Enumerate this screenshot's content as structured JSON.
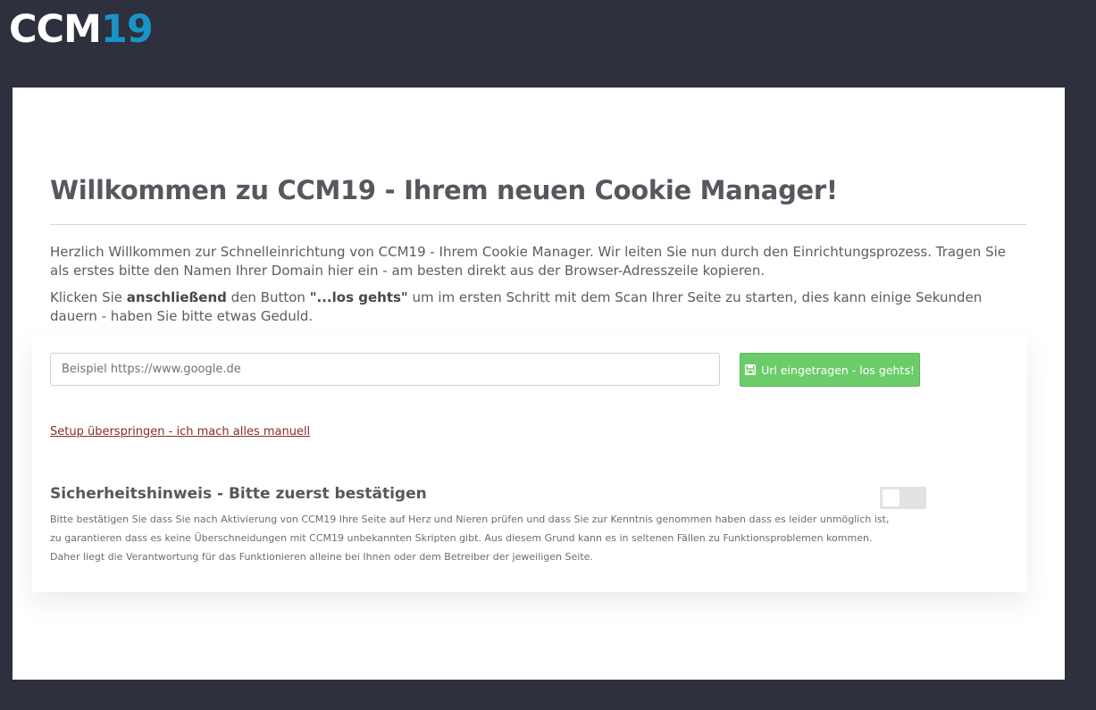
{
  "logo": {
    "part1": "CCM",
    "part2": "19"
  },
  "page": {
    "title": "Willkommen zu CCM19 - Ihrem neuen Cookie Manager!",
    "intro": "Herzlich Willkommen zur Schnelleinrichtung von CCM19 - Ihrem Cookie Manager. Wir leiten Sie nun durch den Einrichtungsprozess. Tragen Sie als erstes bitte den Namen Ihrer Domain hier ein - am besten direkt aus der Browser-Adresszeile kopieren.",
    "instruction_pre": "Klicken Sie ",
    "instruction_bold1": "anschließend",
    "instruction_mid": " den Button ",
    "instruction_bold2": "\"...los gehts\"",
    "instruction_post": " um im ersten Schritt mit dem Scan Ihrer Seite zu starten, dies kann einige Sekunden dauern - haben Sie bitte etwas Geduld."
  },
  "form": {
    "url_placeholder": "Beispiel https://www.google.de",
    "url_value": "",
    "submit_label": "Url eingetragen - los gehts!",
    "skip_link": "Setup überspringen - ich mach alles manuell"
  },
  "security": {
    "heading": "Sicherheitshinweis - Bitte zuerst bestätigen",
    "text": "Bitte bestätigen Sie dass Sie nach Aktivierung von CCM19 Ihre Seite auf Herz und Nieren prüfen und dass Sie zur Kenntnis genommen haben dass es leider unmöglich ist, zu garantieren dass es keine Überschneidungen mit CCM19 unbekannten Skripten gibt. Aus diesem Grund kann es in seltenen Fällen zu Funktionsproblemen kommen. Daher liegt die Verantwortung für das Funktionieren alleine bei Ihnen oder dem Betreiber der jeweiligen Seite.",
    "toggle_on": false
  },
  "colors": {
    "background": "#2e303e",
    "accent": "#1a93c8",
    "button_green": "#6ccc6a",
    "link": "#8b2a2a"
  },
  "icons": {
    "submit_icon": "save-icon"
  }
}
